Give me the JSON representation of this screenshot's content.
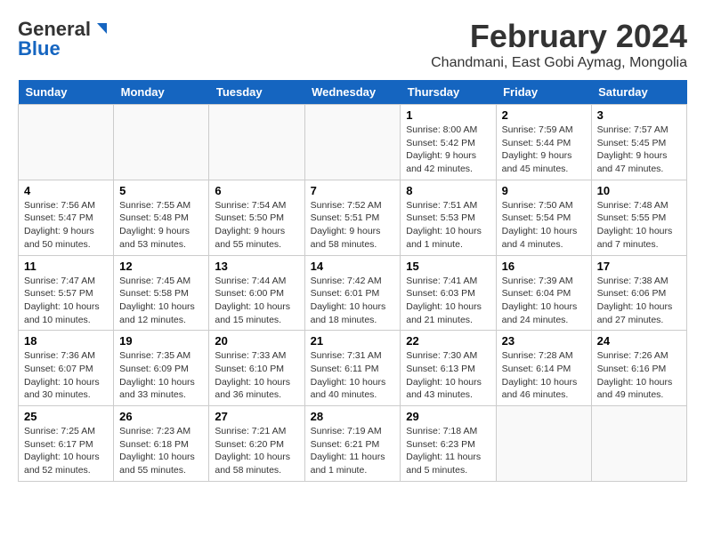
{
  "header": {
    "logo_general": "General",
    "logo_blue": "Blue",
    "title": "February 2024",
    "subtitle": "Chandmani, East Gobi Aymag, Mongolia"
  },
  "weekdays": [
    "Sunday",
    "Monday",
    "Tuesday",
    "Wednesday",
    "Thursday",
    "Friday",
    "Saturday"
  ],
  "weeks": [
    [
      {
        "day": "",
        "info": ""
      },
      {
        "day": "",
        "info": ""
      },
      {
        "day": "",
        "info": ""
      },
      {
        "day": "",
        "info": ""
      },
      {
        "day": "1",
        "info": "Sunrise: 8:00 AM\nSunset: 5:42 PM\nDaylight: 9 hours\nand 42 minutes."
      },
      {
        "day": "2",
        "info": "Sunrise: 7:59 AM\nSunset: 5:44 PM\nDaylight: 9 hours\nand 45 minutes."
      },
      {
        "day": "3",
        "info": "Sunrise: 7:57 AM\nSunset: 5:45 PM\nDaylight: 9 hours\nand 47 minutes."
      }
    ],
    [
      {
        "day": "4",
        "info": "Sunrise: 7:56 AM\nSunset: 5:47 PM\nDaylight: 9 hours\nand 50 minutes."
      },
      {
        "day": "5",
        "info": "Sunrise: 7:55 AM\nSunset: 5:48 PM\nDaylight: 9 hours\nand 53 minutes."
      },
      {
        "day": "6",
        "info": "Sunrise: 7:54 AM\nSunset: 5:50 PM\nDaylight: 9 hours\nand 55 minutes."
      },
      {
        "day": "7",
        "info": "Sunrise: 7:52 AM\nSunset: 5:51 PM\nDaylight: 9 hours\nand 58 minutes."
      },
      {
        "day": "8",
        "info": "Sunrise: 7:51 AM\nSunset: 5:53 PM\nDaylight: 10 hours\nand 1 minute."
      },
      {
        "day": "9",
        "info": "Sunrise: 7:50 AM\nSunset: 5:54 PM\nDaylight: 10 hours\nand 4 minutes."
      },
      {
        "day": "10",
        "info": "Sunrise: 7:48 AM\nSunset: 5:55 PM\nDaylight: 10 hours\nand 7 minutes."
      }
    ],
    [
      {
        "day": "11",
        "info": "Sunrise: 7:47 AM\nSunset: 5:57 PM\nDaylight: 10 hours\nand 10 minutes."
      },
      {
        "day": "12",
        "info": "Sunrise: 7:45 AM\nSunset: 5:58 PM\nDaylight: 10 hours\nand 12 minutes."
      },
      {
        "day": "13",
        "info": "Sunrise: 7:44 AM\nSunset: 6:00 PM\nDaylight: 10 hours\nand 15 minutes."
      },
      {
        "day": "14",
        "info": "Sunrise: 7:42 AM\nSunset: 6:01 PM\nDaylight: 10 hours\nand 18 minutes."
      },
      {
        "day": "15",
        "info": "Sunrise: 7:41 AM\nSunset: 6:03 PM\nDaylight: 10 hours\nand 21 minutes."
      },
      {
        "day": "16",
        "info": "Sunrise: 7:39 AM\nSunset: 6:04 PM\nDaylight: 10 hours\nand 24 minutes."
      },
      {
        "day": "17",
        "info": "Sunrise: 7:38 AM\nSunset: 6:06 PM\nDaylight: 10 hours\nand 27 minutes."
      }
    ],
    [
      {
        "day": "18",
        "info": "Sunrise: 7:36 AM\nSunset: 6:07 PM\nDaylight: 10 hours\nand 30 minutes."
      },
      {
        "day": "19",
        "info": "Sunrise: 7:35 AM\nSunset: 6:09 PM\nDaylight: 10 hours\nand 33 minutes."
      },
      {
        "day": "20",
        "info": "Sunrise: 7:33 AM\nSunset: 6:10 PM\nDaylight: 10 hours\nand 36 minutes."
      },
      {
        "day": "21",
        "info": "Sunrise: 7:31 AM\nSunset: 6:11 PM\nDaylight: 10 hours\nand 40 minutes."
      },
      {
        "day": "22",
        "info": "Sunrise: 7:30 AM\nSunset: 6:13 PM\nDaylight: 10 hours\nand 43 minutes."
      },
      {
        "day": "23",
        "info": "Sunrise: 7:28 AM\nSunset: 6:14 PM\nDaylight: 10 hours\nand 46 minutes."
      },
      {
        "day": "24",
        "info": "Sunrise: 7:26 AM\nSunset: 6:16 PM\nDaylight: 10 hours\nand 49 minutes."
      }
    ],
    [
      {
        "day": "25",
        "info": "Sunrise: 7:25 AM\nSunset: 6:17 PM\nDaylight: 10 hours\nand 52 minutes."
      },
      {
        "day": "26",
        "info": "Sunrise: 7:23 AM\nSunset: 6:18 PM\nDaylight: 10 hours\nand 55 minutes."
      },
      {
        "day": "27",
        "info": "Sunrise: 7:21 AM\nSunset: 6:20 PM\nDaylight: 10 hours\nand 58 minutes."
      },
      {
        "day": "28",
        "info": "Sunrise: 7:19 AM\nSunset: 6:21 PM\nDaylight: 11 hours\nand 1 minute."
      },
      {
        "day": "29",
        "info": "Sunrise: 7:18 AM\nSunset: 6:23 PM\nDaylight: 11 hours\nand 5 minutes."
      },
      {
        "day": "",
        "info": ""
      },
      {
        "day": "",
        "info": ""
      }
    ]
  ]
}
